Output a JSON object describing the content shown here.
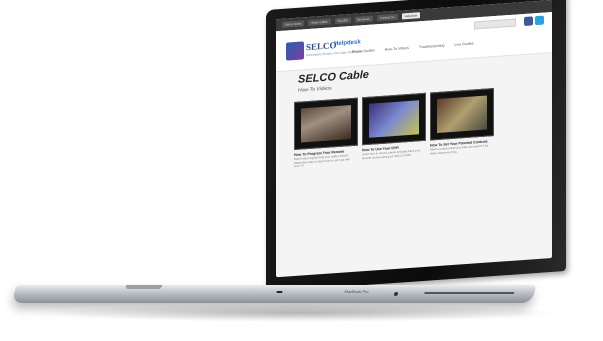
{
  "top_links": [
    "Selco Home",
    "Selco Cable",
    "Pay Bill",
    "Business",
    "Contact Us",
    "Helpdesk"
  ],
  "active_top_link": "Helpdesk",
  "logo": {
    "name": "SELCO",
    "badge": "Helpdesk",
    "tagline": "Shrewsbury Electric and Cable Operations"
  },
  "nav": [
    "Phone Guides",
    "How-To Videos",
    "Troubleshooting",
    "Live Guides"
  ],
  "page": {
    "title": "SELCO Cable",
    "subtitle": "How-To Videos"
  },
  "videos": [
    {
      "title": "How To Program Your Remote",
      "desc": "Need help programming your cable remote? Watch this video to learn how to set it up with your TV."
    },
    {
      "title": "How To Use Your DVR",
      "desc": "Learn how to record, pause and play back your favorite shows using your SELCO DVR."
    },
    {
      "title": "How To Set Your Parental Controls",
      "desc": "Want to restrict what your kids can watch? This video shows you how."
    }
  ],
  "laptop_brand": "MacBook Pro",
  "colors": {
    "facebook": "#3b5998",
    "twitter": "#2aa3e0",
    "brand_blue": "#2b4f9a"
  }
}
